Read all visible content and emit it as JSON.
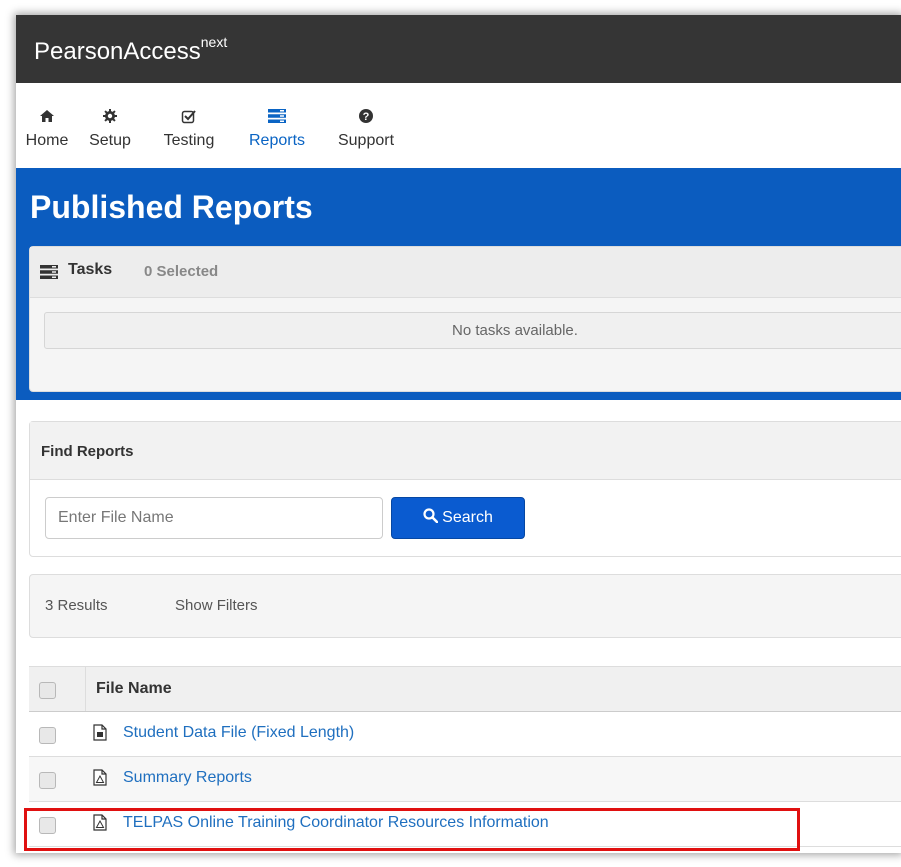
{
  "app": {
    "brand": "PearsonAccess",
    "brand_sup": "next"
  },
  "nav": {
    "items": [
      {
        "id": "home",
        "label": "Home",
        "icon": "home-icon"
      },
      {
        "id": "setup",
        "label": "Setup",
        "icon": "gear-icon"
      },
      {
        "id": "testing",
        "label": "Testing",
        "icon": "checkbox-icon"
      },
      {
        "id": "reports",
        "label": "Reports",
        "icon": "reports-icon",
        "active": true
      },
      {
        "id": "support",
        "label": "Support",
        "icon": "question-icon"
      }
    ]
  },
  "page": {
    "title": "Published Reports"
  },
  "tasks": {
    "title": "Tasks",
    "selected": "0 Selected",
    "empty": "No tasks available."
  },
  "find": {
    "title": "Find Reports",
    "placeholder": "Enter File Name",
    "search_label": "Search"
  },
  "results": {
    "count": "3 Results",
    "filters_label": "Show Filters"
  },
  "table": {
    "header": "File Name",
    "rows": [
      {
        "name": "Student Data File (Fixed Length)",
        "icon": "text-file-icon"
      },
      {
        "name": "Summary Reports",
        "icon": "pdf-file-icon"
      },
      {
        "name": "TELPAS Online Training Coordinator Resources Information",
        "icon": "pdf-file-icon",
        "highlighted": true
      }
    ]
  },
  "colors": {
    "topbar": "#353535",
    "accent_blue": "#0b5cbf",
    "link": "#1f6fbf",
    "highlight_border": "#e01010"
  }
}
